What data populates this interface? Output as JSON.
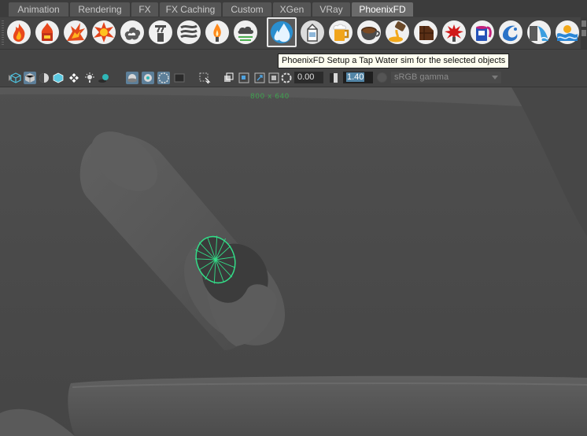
{
  "shelf_tabs": [
    {
      "label": "Animation",
      "active": false
    },
    {
      "label": "Rendering",
      "active": false
    },
    {
      "label": "FX",
      "active": false
    },
    {
      "label": "FX Caching",
      "active": false
    },
    {
      "label": "Custom",
      "active": false
    },
    {
      "label": "XGen",
      "active": false
    },
    {
      "label": "VRay",
      "active": false
    },
    {
      "label": "PhoenixFD",
      "active": true
    }
  ],
  "shelf_buttons": [
    "fire-sim-icon",
    "fuel-fire-icon",
    "explosion-icon",
    "bomb-explosion-icon",
    "smoke-sim-icon",
    "steam-sim-icon",
    "smoke-trail-icon",
    "candle-flame-icon",
    "cloud-fog-icon",
    "tap-water-icon",
    "milk-carton-icon",
    "beer-mug-icon",
    "coffee-cup-icon",
    "honey-pour-icon",
    "chocolate-icon",
    "blood-splash-icon",
    "paint-can-icon",
    "water-splash-icon",
    "waterfall-icon",
    "ocean-waves-icon"
  ],
  "selected_shelf_button": "tap-water-icon",
  "tooltip": "PhoenixFD Setup a Tap Water sim for the selected objects",
  "panel_toolbar": {
    "exposure_value": "0.00",
    "gamma_value": "1.40",
    "color_space": "sRGB gamma"
  },
  "viewport": {
    "resolution_label": "800 x 640"
  },
  "colors": {
    "ui_bg": "#444444",
    "viewport_bg": "#4b4b4b",
    "active_tab": "#6b6b6b",
    "selection_green": "#33dd88",
    "resolution_gate_text": "#3fa04f"
  }
}
